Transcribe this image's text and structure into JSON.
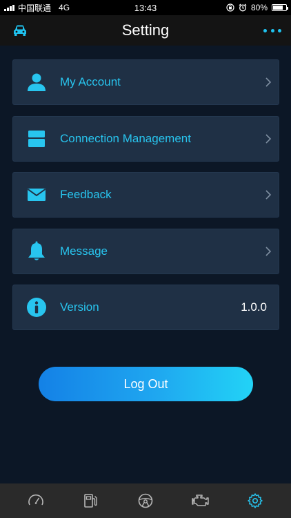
{
  "status_bar": {
    "carrier": "中国联通",
    "network": "4G",
    "time": "13:43",
    "battery": "80%",
    "battery_level": 0.8
  },
  "header": {
    "title": "Setting",
    "left_icon": "car-icon",
    "right_icon": "more-icon"
  },
  "menu": [
    {
      "label": "My Account",
      "icon": "user-icon",
      "chevron": true
    },
    {
      "label": "Connection Management",
      "icon": "device-icon",
      "chevron": true
    },
    {
      "label": "Feedback",
      "icon": "mail-icon",
      "chevron": true
    },
    {
      "label": "Message",
      "icon": "bell-icon",
      "chevron": true
    },
    {
      "label": "Version",
      "icon": "info-icon",
      "value": "1.0.0"
    }
  ],
  "logout_label": "Log Out",
  "tabs": [
    {
      "icon": "speedometer-icon",
      "active": false
    },
    {
      "icon": "fuel-icon",
      "active": false
    },
    {
      "icon": "steering-wheel-icon",
      "active": false
    },
    {
      "icon": "engine-icon",
      "active": false
    },
    {
      "icon": "gear-icon",
      "active": true
    }
  ],
  "colors": {
    "accent": "#28c5ef",
    "background": "#0c1726",
    "row": "#1f3045",
    "header": "#141414",
    "tabbar": "#2a2a2a",
    "tab_inactive": "#b8b8b8"
  }
}
